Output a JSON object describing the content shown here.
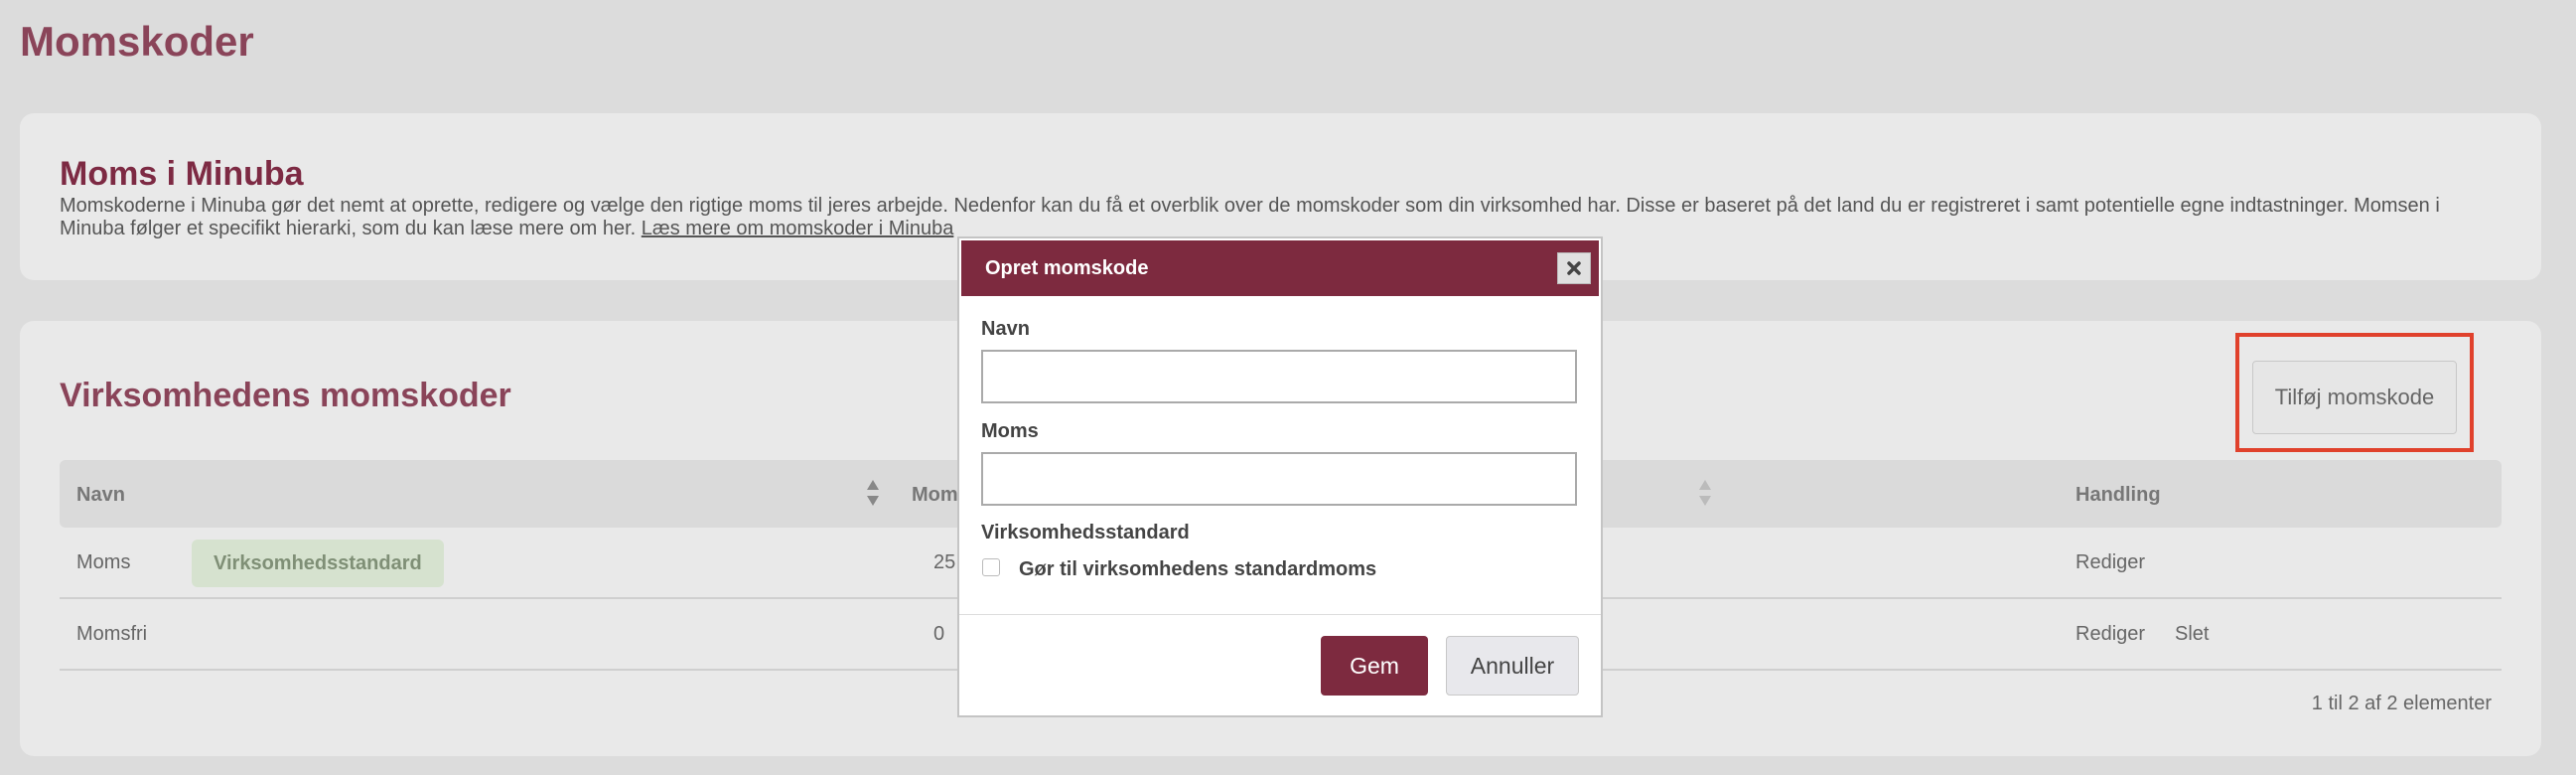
{
  "page": {
    "title": "Momskoder"
  },
  "info": {
    "heading": "Moms i Minuba",
    "body": "Momskoderne i Minuba gør det nemt at oprette, redigere og vælge den rigtige moms til jeres arbejde. Nedenfor kan du få et overblik over de momskoder som din virksomhed har. Disse er baseret på det land du er registreret i samt potentielle egne indtastninger. Momsen i Minuba følger et specifikt hierarki, som du kan læse mere om her. ",
    "link": "Læs mere om momskoder i Minuba"
  },
  "codes": {
    "heading": "Virksomhedens momskoder",
    "add_button": "Tilføj momskode",
    "columns": {
      "name": "Navn",
      "vat": "Moms",
      "action": "Handling"
    },
    "rows": [
      {
        "name": "Moms",
        "badge": "Virksomhedsstandard",
        "vat": "25",
        "actions": [
          "Rediger"
        ]
      },
      {
        "name": "Momsfri",
        "badge": "",
        "vat": "0",
        "actions": [
          "Rediger",
          "Slet"
        ]
      }
    ],
    "pager": "1 til 2 af 2 elementer"
  },
  "modal": {
    "title": "Opret momskode",
    "close_icon": "close-icon",
    "name_label": "Navn",
    "name_value": "",
    "vat_label": "Moms",
    "vat_value": "",
    "standard_label": "Virksomhedsstandard",
    "standard_checkbox_label": "Gør til virksomhedens standardmoms",
    "standard_checked": false,
    "save_label": "Gem",
    "cancel_label": "Annuller"
  },
  "colors": {
    "brand": "#7d2a3f",
    "heading": "#8a4459",
    "highlight": "#e0412c",
    "badge_bg": "#d6e2cf"
  }
}
